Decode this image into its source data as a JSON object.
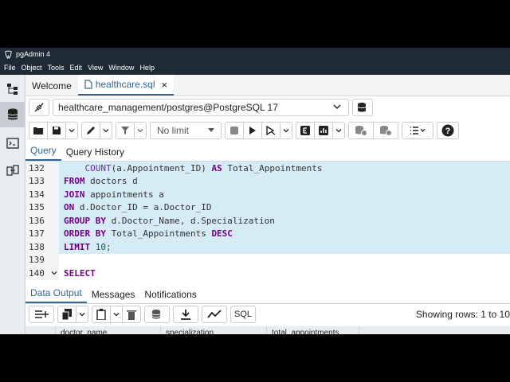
{
  "app": {
    "title": "pgAdmin 4"
  },
  "menu": [
    "File",
    "Object",
    "Tools",
    "Edit",
    "View",
    "Window",
    "Help"
  ],
  "tabs": {
    "welcome": "Welcome",
    "file": "healthcare.sql",
    "close": "×"
  },
  "connection": {
    "value": "healthcare_management/postgres@PostgreSQL 17"
  },
  "toolbar": {
    "limit": "No limit"
  },
  "query_tabs": {
    "query": "Query",
    "history": "Query History"
  },
  "editor": {
    "lines": [
      {
        "num": "132",
        "tokens": [
          "    ",
          "COUNT",
          "(a.Appointment_ID) ",
          "AS",
          " Total_Appointments"
        ]
      },
      {
        "num": "133",
        "tokens": [
          "FROM",
          " doctors d"
        ]
      },
      {
        "num": "134",
        "tokens": [
          "JOIN",
          " appointments a"
        ]
      },
      {
        "num": "135",
        "tokens": [
          "ON",
          " d.Doctor_ID = a.Doctor_ID"
        ]
      },
      {
        "num": "136",
        "tokens": [
          "GROUP BY",
          " d.Doctor_Name, d.Specialization"
        ]
      },
      {
        "num": "137",
        "tokens": [
          "ORDER BY",
          " Total_Appointments ",
          "DESC"
        ]
      },
      {
        "num": "138",
        "tokens": [
          "LIMIT",
          " ",
          "10",
          ";"
        ]
      },
      {
        "num": "139",
        "tokens": [
          ""
        ]
      },
      {
        "num": "140",
        "tokens": [
          "SELECT"
        ]
      }
    ]
  },
  "output_tabs": {
    "data": "Data Output",
    "messages": "Messages",
    "notifications": "Notifications"
  },
  "output": {
    "sql_label": "SQL",
    "showing": "Showing rows: 1 to 10"
  },
  "grid": {
    "columns": [
      "doctor_name",
      "specialization",
      "total_appointments"
    ]
  }
}
